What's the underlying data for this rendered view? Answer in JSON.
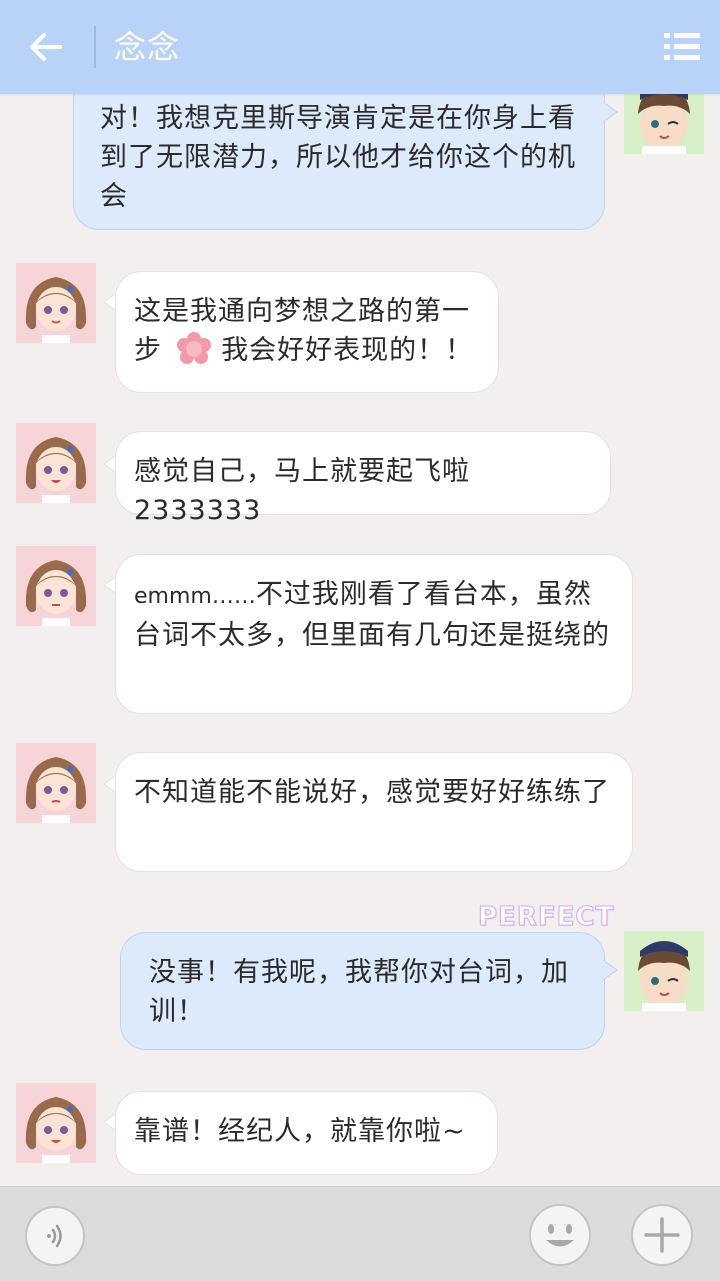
{
  "header": {
    "title": "念念"
  },
  "messages": [
    {
      "side": "right",
      "text": "对！我想克里斯导演肯定是在你身上看到了无限潜力，所以他才给你这个的机会"
    },
    {
      "side": "left",
      "text_before": "这是我通向梦想之路的第一步",
      "text_after": "我会好好表现的！！",
      "inline_icon": "pink-flower-icon"
    },
    {
      "side": "left",
      "text": "感觉自己，马上就要起飞啦2333333"
    },
    {
      "side": "left",
      "text_prefix": "emmm……",
      "text": "不过我刚看了看台本，虽然台词不太多，但里面有几句还是挺绕的"
    },
    {
      "side": "left",
      "text": "不知道能不能说好，感觉要好好练练了"
    },
    {
      "side": "right",
      "text": "没事！有我呢，我帮你对台词，加训！",
      "badge": "PERFECT"
    },
    {
      "side": "left",
      "text": "靠谱！经纪人，就靠你啦~"
    }
  ],
  "colors": {
    "header": "#b9d2f8",
    "background": "#f3efee",
    "bubble_left": "#ffffff",
    "bubble_right": "#ddeafb",
    "bottom_bar": "#dcdcdc"
  },
  "icons": {
    "back": "arrow-left-icon",
    "menu": "list-menu-icon",
    "voice": "voice-icon",
    "emoji": "smiley-icon",
    "plus": "plus-icon"
  }
}
